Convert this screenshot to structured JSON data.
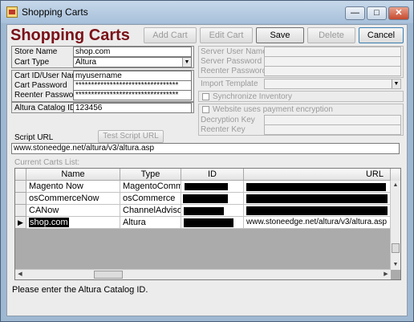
{
  "window": {
    "title": "Shopping Carts",
    "min_glyph": "—",
    "max_glyph": "□",
    "close_glyph": "✕"
  },
  "heading": "Shopping Carts",
  "toolbar": {
    "add_cart": "Add Cart",
    "edit_cart": "Edit Cart",
    "save": "Save",
    "delete": "Delete",
    "cancel": "Cancel"
  },
  "left": {
    "store_name_label": "Store Name",
    "store_name_value": "shop.com",
    "cart_type_label": "Cart Type",
    "cart_type_value": "Altura",
    "cart_id_label": "Cart ID/User Name",
    "cart_id_value": "myusername",
    "cart_password_label": "Cart Password",
    "cart_password_value": "*********************************",
    "reenter_password_label": "Reenter Password",
    "reenter_password_value": "*********************************",
    "catalog_id_label": "Altura Catalog ID",
    "catalog_id_value": "123456"
  },
  "right": {
    "server_user_label": "Server User Name",
    "server_password_label": "Server Password",
    "server_reenter_label": "Reenter Password",
    "import_template_label": "Import Template",
    "sync_inventory_label": "Synchronize Inventory",
    "encryption_label": "Website uses payment encryption",
    "decryption_key_label": "Decryption Key",
    "reenter_key_label": "Reenter Key"
  },
  "script": {
    "label": "Script URL",
    "test_button": "Test Script URL",
    "value": "www.stoneedge.net/altura/v3/altura.asp"
  },
  "carts": {
    "list_label": "Current Carts List:",
    "columns": [
      "Name",
      "Type",
      "ID",
      "URL"
    ],
    "rows": [
      {
        "name": "Magento Now",
        "type": "MagentoComme",
        "id": "",
        "url": ""
      },
      {
        "name": "osCommerceNow",
        "type": "osCommerce",
        "id": "",
        "url": ""
      },
      {
        "name": "CANow",
        "type": "ChannelAdvisor",
        "id": "",
        "url": ""
      },
      {
        "name": "shop.com",
        "type": "Altura",
        "id": "",
        "url": "www.stoneedge.net/altura/v3/altura.asp"
      }
    ],
    "current_row_marker": "▶"
  },
  "status": "Please enter the Altura Catalog ID.",
  "colors": {
    "heading": "#7a1118",
    "titlebar": "#b9cde2"
  }
}
